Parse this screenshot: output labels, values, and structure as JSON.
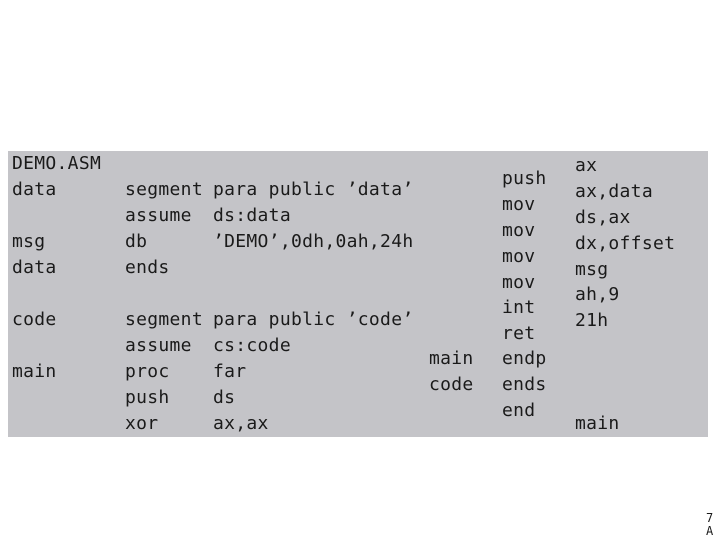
{
  "left_block": {
    "header": "DEMO.ASM",
    "rows": [
      [
        "data",
        "segment",
        "para public ’data’"
      ],
      [
        "",
        "assume",
        "ds:data"
      ],
      [
        "msg",
        "db",
        "’DEMO’,0dh,0ah,24h"
      ],
      [
        "data",
        "ends",
        ""
      ],
      [
        "",
        "",
        ""
      ],
      [
        "code",
        "segment",
        "para public ’code’"
      ],
      [
        "",
        "assume",
        "cs:code"
      ],
      [
        "main",
        "proc",
        "far"
      ],
      [
        "",
        "push",
        "ds"
      ],
      [
        "",
        "xor",
        "ax,ax"
      ]
    ]
  },
  "middle_block": {
    "labels": [
      "main",
      "code"
    ]
  },
  "right_block": {
    "mnemonics": [
      "push",
      "mov",
      "mov",
      "mov",
      "mov",
      "int",
      "ret",
      "endp",
      "ends",
      "end"
    ],
    "operands": [
      "ax",
      "ax,data",
      "ds,ax",
      "dx,offset",
      "msg",
      "ah,9",
      "21h",
      "",
      "",
      "",
      "main"
    ]
  },
  "page_number": "7 A",
  "colors": {
    "panel_bg": "#c4c4c8",
    "text": "#1a1a1a"
  }
}
